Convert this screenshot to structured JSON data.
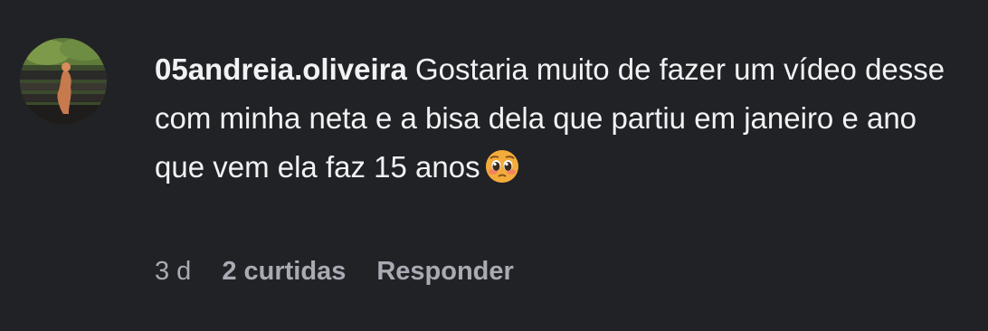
{
  "comment": {
    "avatar_icon": "user-avatar-photo",
    "username": "05andreia.oliveira",
    "text": "Gostaria muito de fazer um vídeo desse com minha neta e a bisa dela que partiu em janeiro e ano que vem ela faz 15 anos",
    "emoji_icon": "pleading-face-emoji",
    "time": "3 d",
    "likes": "2 curtidas",
    "reply_label": "Responder"
  },
  "colors": {
    "background": "#212226",
    "text": "#f1f2f4",
    "meta": "#a8abb3"
  }
}
